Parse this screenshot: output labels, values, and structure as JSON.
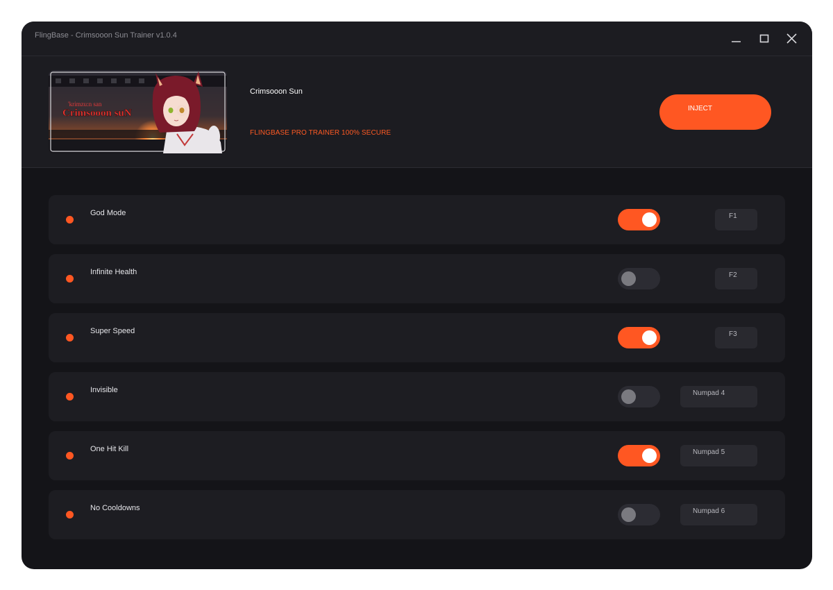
{
  "window": {
    "title": "FlingBase - Crimsooon Sun Trainer v1.0.4",
    "controls": [
      "minimize-icon",
      "maximize-icon",
      "close-icon"
    ]
  },
  "header": {
    "game_title": "Crimsooon Sun",
    "subtitle": "FLINGBASE PRO TRAINER  100% SECURE",
    "inject_label": "INJECT",
    "banner": {
      "logo_top": "'krimzu:n san",
      "logo_main": "Crimsooon suN"
    }
  },
  "cheats": [
    {
      "name": "God Mode",
      "enabled": true,
      "hotkey": "F1"
    },
    {
      "name": "Infinite Health",
      "enabled": false,
      "hotkey": "F2"
    },
    {
      "name": "Super Speed",
      "enabled": true,
      "hotkey": "F3"
    },
    {
      "name": "Invisible",
      "enabled": false,
      "hotkey": "Numpad 4"
    },
    {
      "name": "One Hit Kill",
      "enabled": true,
      "hotkey": "Numpad 5"
    },
    {
      "name": "No Cooldowns",
      "enabled": false,
      "hotkey": "Numpad 6"
    }
  ],
  "colors": {
    "accent": "#ff5722",
    "background": "#141418",
    "panel": "#1c1c21",
    "row": "#1d1d22"
  }
}
